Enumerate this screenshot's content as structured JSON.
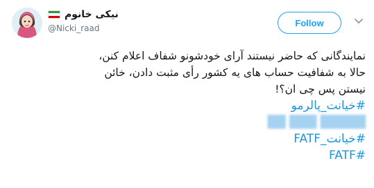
{
  "user": {
    "display_name": "نیکی خانوم",
    "handle": "@Nicki_raad",
    "avatar_icon": "cartoon-woman-hijab-avatar",
    "flag_icon": "iran-flag-icon"
  },
  "actions": {
    "follow_label": "Follow",
    "menu_icon": "chevron-down-icon"
  },
  "tweet": {
    "lines": [
      "نمایندگانی که حاضر نیستند آرای خودشونو شفاف اعلام کنن،",
      "حالا به شفافیت حساب های یه کشور رأی مثبت دادن، خائن",
      "نیستن پس چی ان؟!"
    ],
    "hashtags": [
      "#خیانت_پالرمو",
      "#خیانت_FATF",
      "#FATF"
    ]
  },
  "colors": {
    "accent": "#1da1f2",
    "hashtag": "#1b95e0",
    "text": "#14171a",
    "secondary": "#657786"
  }
}
